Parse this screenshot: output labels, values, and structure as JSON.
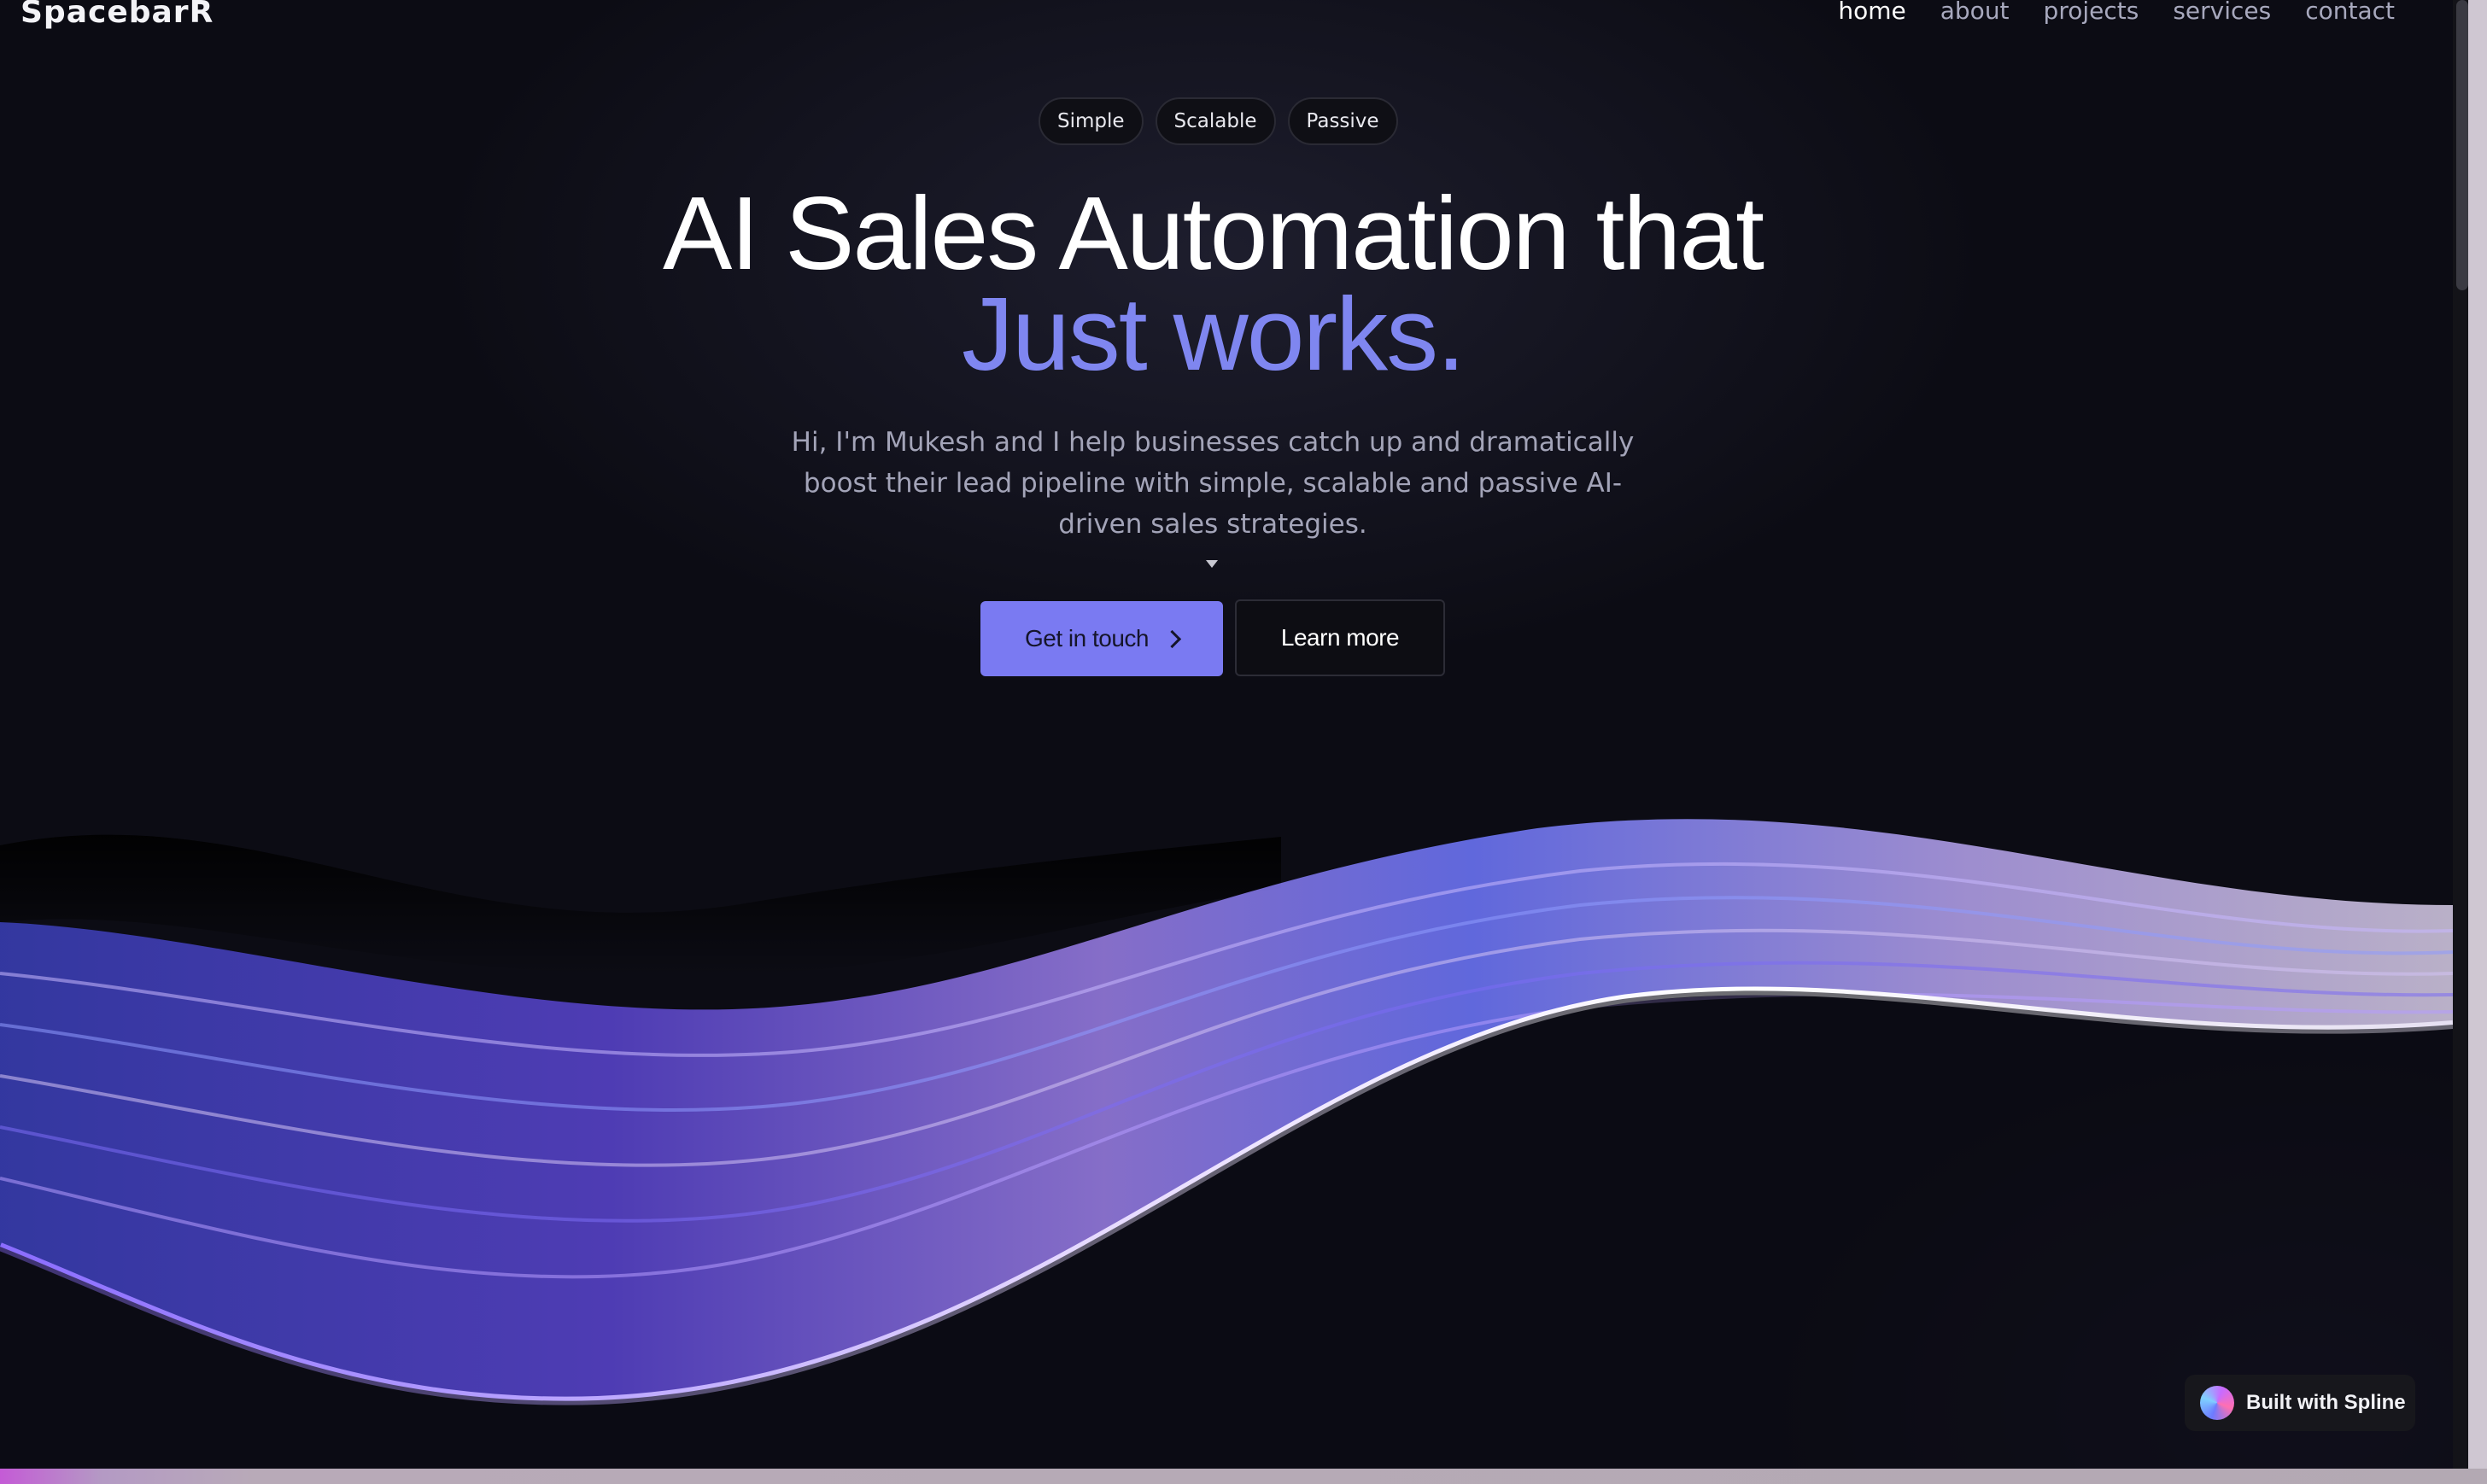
{
  "brand": {
    "name": "SpacebarR"
  },
  "nav": {
    "items": [
      {
        "label": "home",
        "active": true
      },
      {
        "label": "about",
        "active": false
      },
      {
        "label": "projects",
        "active": false
      },
      {
        "label": "services",
        "active": false
      },
      {
        "label": "contact",
        "active": false
      }
    ]
  },
  "hero": {
    "pills": [
      "Simple",
      "Scalable",
      "Passive"
    ],
    "title_line1": "AI Sales Automation that",
    "title_line2": "Just works.",
    "subtitle": "Hi, I'm Mukesh and I help businesses catch up and dramatically boost their lead pipeline with simple, scalable and passive AI-driven sales strategies.",
    "primary_cta": "Get in touch",
    "secondary_cta": "Learn more"
  },
  "badge": {
    "label": "Built with Spline"
  },
  "colors": {
    "background": "#0c0c14",
    "accent": "#7f86f0",
    "primary_button": "#7a7af2",
    "muted_text": "#a3a4b8"
  },
  "icons": {
    "cta_arrow": "chevron-right-icon",
    "scroll_hint": "caret-down-icon",
    "badge_logo": "spline-logo-icon"
  }
}
